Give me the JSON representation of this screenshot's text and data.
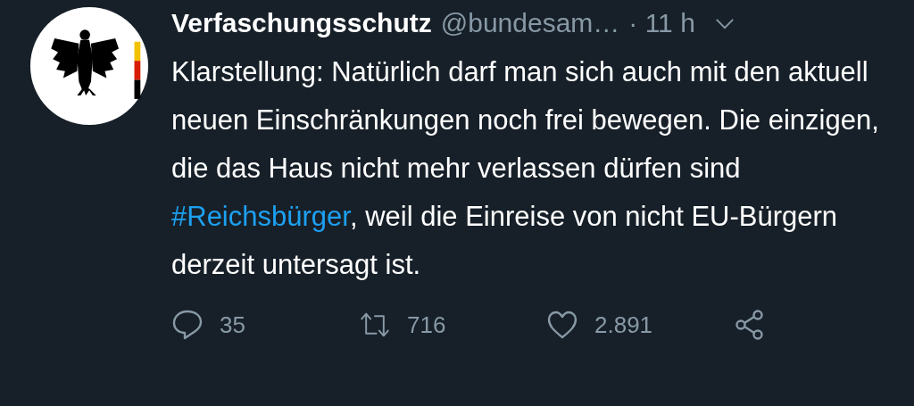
{
  "tweet": {
    "display_name": "Verfaschungsschutz",
    "handle": "@bundesam…",
    "time": "· 11 h",
    "text": [
      {
        "kind": "plain",
        "text": "Klarstellung: Natürlich darf man sich auch mit den aktuell neuen Einschränkungen noch frei bewegen. Die einzigen, die das Haus nicht mehr verlassen dürfen sind "
      },
      {
        "kind": "hashtag",
        "text": "#Reichsbürger"
      },
      {
        "kind": "plain",
        "text": ", weil die Einreise von nicht EU-Bürgern derzeit untersagt ist."
      }
    ],
    "actions": [
      {
        "kind": "reply",
        "count": "35"
      },
      {
        "kind": "retweet",
        "count": "716"
      },
      {
        "kind": "like",
        "count": "2.891"
      },
      {
        "kind": "share"
      }
    ]
  }
}
